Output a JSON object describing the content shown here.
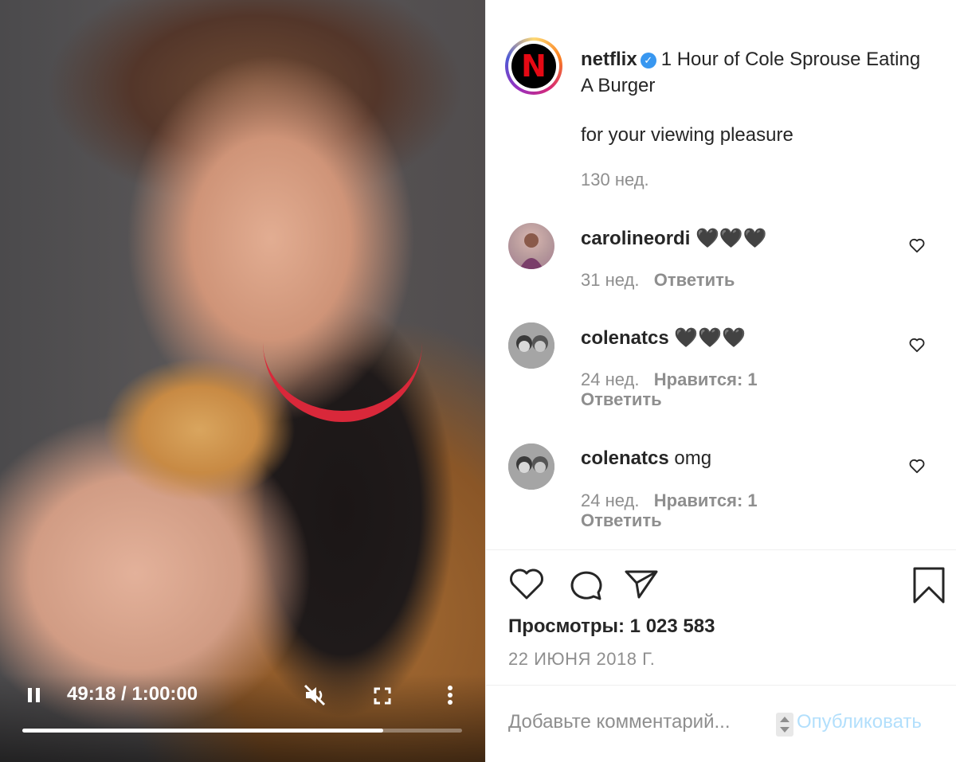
{
  "player": {
    "time_display": "49:18 / 1:00:00",
    "progress_fraction": 0.82,
    "icons": [
      "pause-icon",
      "muted-speaker-icon",
      "fullscreen-icon",
      "more-vertical-icon"
    ]
  },
  "post": {
    "username": "netflix",
    "title": "1 Hour of Cole Sprouse Eating A Burger",
    "description": "for your viewing pleasure",
    "age": "130 нед."
  },
  "comments": [
    {
      "username": "carolineordi",
      "text": "🖤🖤🖤",
      "age": "31 нед.",
      "likes": "",
      "reply": "Ответить"
    },
    {
      "username": "colenatcs",
      "text": "🖤🖤🖤",
      "age": "24 нед.",
      "likes": "Нравится: 1",
      "reply": "Ответить"
    },
    {
      "username": "colenatcs",
      "text": "omg",
      "age": "24 нед.",
      "likes": "Нравится: 1",
      "reply": "Ответить"
    }
  ],
  "stats": {
    "views": "Просмотры: 1 023 583",
    "date": "22 ИЮНЯ 2018 Г."
  },
  "composer": {
    "placeholder": "Добавьте комментарий...",
    "publish": "Опубликовать"
  },
  "colors": {
    "verified": "#3897f0",
    "publish_disabled": "#b2dffc",
    "netflix_red": "#e50914",
    "meta_gray": "#8e8e8e"
  }
}
